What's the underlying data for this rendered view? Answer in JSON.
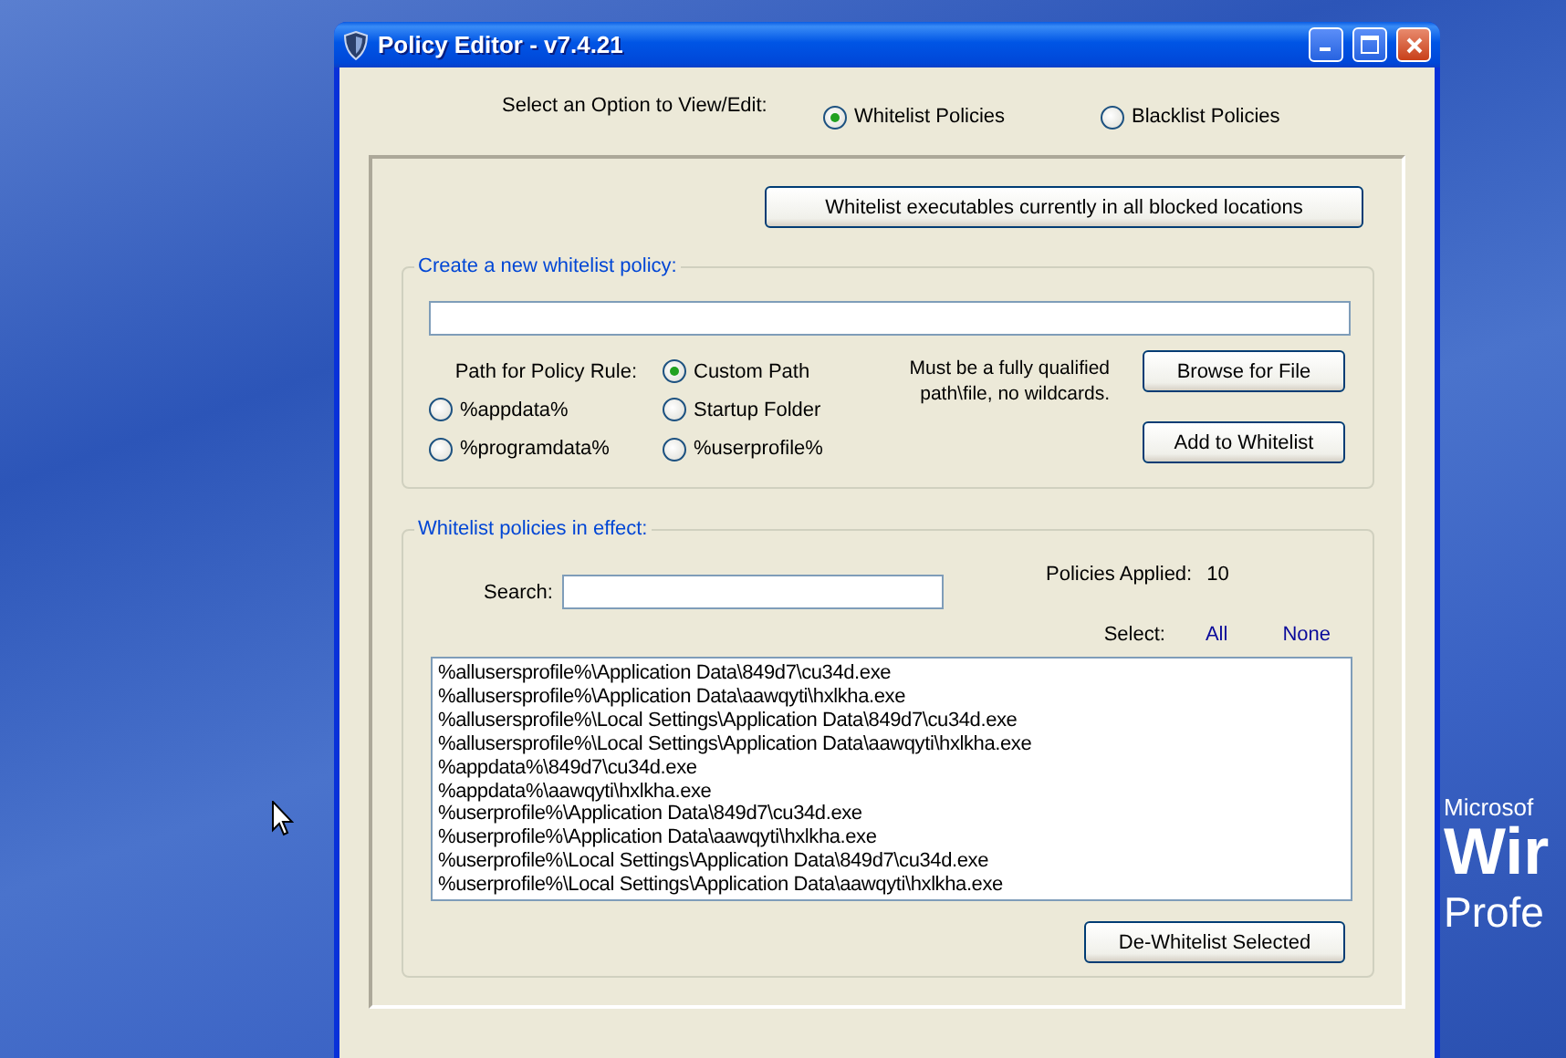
{
  "window": {
    "title": "Policy Editor - v7.4.21"
  },
  "mode": {
    "label": "Select an Option to View/Edit:",
    "options": [
      {
        "label": "Whitelist Policies",
        "selected": true
      },
      {
        "label": "Blacklist Policies",
        "selected": false
      }
    ]
  },
  "whitelist_all_button": "Whitelist executables currently in all blocked locations",
  "new_policy": {
    "title": "Create a new whitelist policy:",
    "path_rule_label": "Path for Policy Rule:",
    "path_options": [
      {
        "label": "Custom Path",
        "selected": true
      },
      {
        "label": "%appdata%",
        "selected": false
      },
      {
        "label": "Startup Folder",
        "selected": false
      },
      {
        "label": "%programdata%",
        "selected": false
      },
      {
        "label": "%userprofile%",
        "selected": false
      }
    ],
    "note": "Must be a fully qualified\npath\\file, no wildcards.",
    "buttons": [
      "Browse for File",
      "Add to Whitelist"
    ]
  },
  "policies": {
    "title": "Whitelist policies in effect:",
    "search_label": "Search:",
    "applied_label": "Policies Applied:",
    "applied_count": "10",
    "select_label": "Select:",
    "select_links": [
      "All",
      "None"
    ],
    "items": [
      {
        "text": "%allusersprofile%\\Application Data\\849d7\\cu34d.exe",
        "selected": false
      },
      {
        "text": "%allusersprofile%\\Application Data\\aawqyti\\hxlkha.exe",
        "selected": false
      },
      {
        "text": "%allusersprofile%\\Local Settings\\Application Data\\849d7\\cu34d.exe",
        "selected": false
      },
      {
        "text": "%allusersprofile%\\Local Settings\\Application Data\\aawqyti\\hxlkha.exe",
        "selected": false
      },
      {
        "text": "%appdata%\\849d7\\cu34d.exe",
        "selected": false
      },
      {
        "text": "%appdata%\\aawqyti\\hxlkha.exe",
        "selected": false
      },
      {
        "text": "%userprofile%\\Application Data\\849d7\\cu34d.exe",
        "selected": false
      },
      {
        "text": "%userprofile%\\Application Data\\aawqyti\\hxlkha.exe",
        "selected": false
      },
      {
        "text": "%userprofile%\\Local Settings\\Application Data\\849d7\\cu34d.exe",
        "selected": false
      },
      {
        "text": "%userprofile%\\Local Settings\\Application Data\\aawqyti\\hxlkha.exe",
        "selected": false
      }
    ],
    "button": "De-Whitelist Selected"
  },
  "wallpaper_logo": [
    "Microsof",
    "Wir",
    "Profe"
  ]
}
